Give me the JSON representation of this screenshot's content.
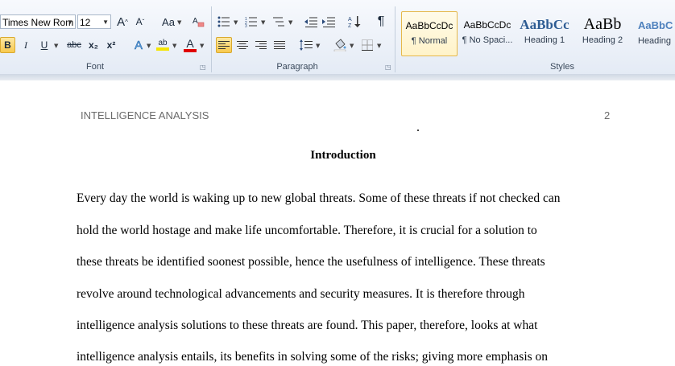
{
  "ribbon": {
    "font_group": {
      "label": "Font",
      "font_name": "Times New Rom",
      "font_size": "12",
      "grow_font": "A",
      "shrink_font": "A",
      "change_case": "Aa",
      "bold": "B",
      "italic": "I",
      "underline": "U",
      "strikethrough": "abc",
      "subscript": "x₂",
      "superscript": "x²",
      "text_effects": "A",
      "highlight": "ab",
      "font_color": "A",
      "highlight_color": "#f5e500",
      "font_color_value": "#e00000"
    },
    "paragraph_group": {
      "label": "Paragraph",
      "pilcrow": "¶"
    },
    "styles_group": {
      "label": "Styles",
      "styles": [
        {
          "sample": "AaBbCcDc",
          "name": "¶ Normal"
        },
        {
          "sample": "AaBbCcDc",
          "name": "¶ No Spaci..."
        },
        {
          "sample": "AaBbCc",
          "name": "Heading 1"
        },
        {
          "sample": "AaBb",
          "name": "Heading 2"
        },
        {
          "sample": "AaBbC",
          "name": "Heading"
        }
      ]
    },
    "accent_color": "#f8c94e"
  },
  "document": {
    "header_text": "INTELLIGENCE ANALYSIS",
    "page_number": "2",
    "title": "Introduction",
    "lines": [
      "Every day the world is waking up to new global threats. Some of these threats if not checked can",
      "hold the world hostage and make life uncomfortable. Therefore, it is crucial for a solution to",
      "these threats be identified soonest possible, hence the usefulness of intelligence.  These threats",
      "revolve around technological advancements and security measures. It is therefore through",
      "intelligence analysis solutions to these threats are found. This paper, therefore, looks at what",
      "intelligence analysis entails, its benefits in solving some of the risks; giving more emphasis on"
    ]
  }
}
